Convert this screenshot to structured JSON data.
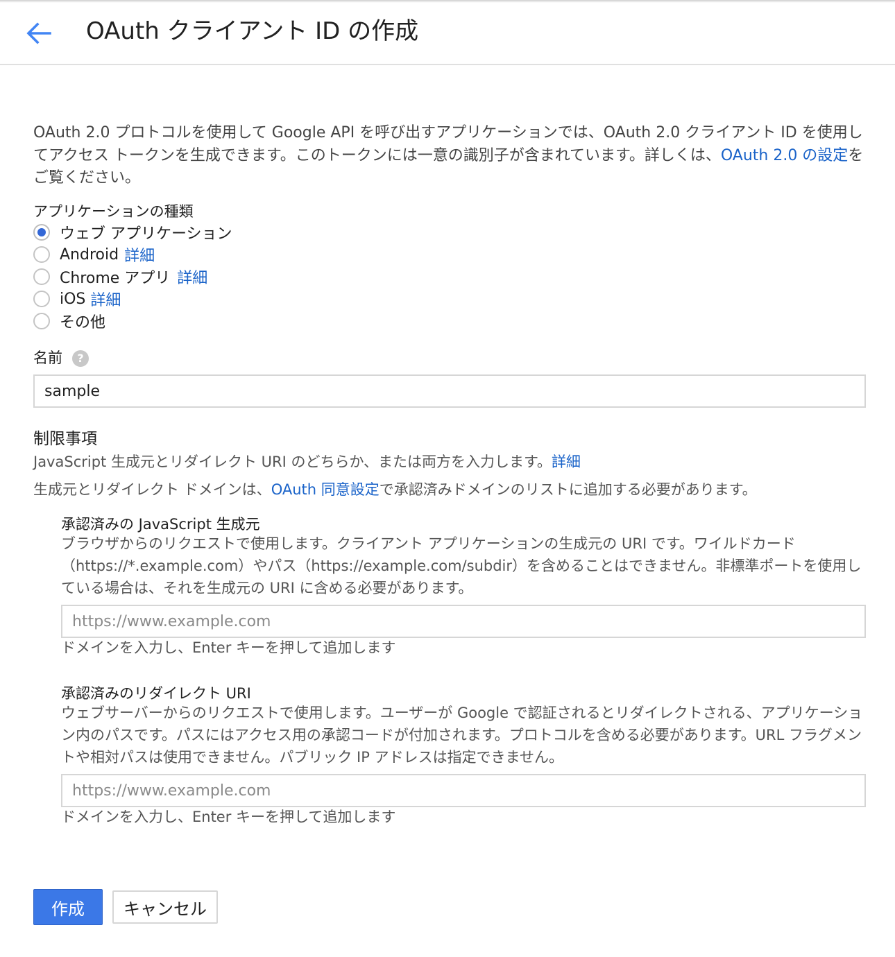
{
  "header": {
    "title": "OAuth クライアント ID の作成",
    "back_icon": "arrow-back-icon",
    "accent_color": "#4285f4"
  },
  "intro": {
    "text_before": "OAuth 2.0 プロトコルを使用して Google API を呼び出すアプリケーションでは、OAuth 2.0 クライアント ID を使用してアクセス トークンを生成できます。このトークンには一意の識別子が含まれています。詳しくは、",
    "link": "OAuth 2.0 の設定",
    "text_after": "をご覧ください。"
  },
  "app_type": {
    "label": "アプリケーションの種類",
    "options": [
      {
        "label": "ウェブ アプリケーション",
        "link": "",
        "checked": true
      },
      {
        "label": "Android",
        "link": "詳細",
        "checked": false
      },
      {
        "label": "Chrome アプリ",
        "link": "詳細",
        "checked": false
      },
      {
        "label": "iOS",
        "link": "詳細",
        "checked": false
      },
      {
        "label": "その他",
        "link": "",
        "checked": false
      }
    ]
  },
  "name": {
    "label": "名前",
    "help_icon": "help-icon",
    "value": "sample"
  },
  "restrictions": {
    "title": "制限事項",
    "desc1_text": "JavaScript 生成元とリダイレクト URI のどちらか、または両方を入力します。",
    "desc1_link": "詳細",
    "desc2_before": "生成元とリダイレクト ドメインは、",
    "desc2_link": "OAuth 同意設定",
    "desc2_after": "で承認済みドメインのリストに追加する必要があります。",
    "js_origins": {
      "title": "承認済みの JavaScript 生成元",
      "description": "ブラウザからのリクエストで使用します。クライアント アプリケーションの生成元の URI です。ワイルドカード（https://*.example.com）やパス（https://example.com/subdir）を含めることはできません。非標準ポートを使用している場合は、それを生成元の URI に含める必要があります。",
      "placeholder": "https://www.example.com",
      "hint": "ドメインを入力し、Enter キーを押して追加します"
    },
    "redirect_uris": {
      "title": "承認済みのリダイレクト URI",
      "description": "ウェブサーバーからのリクエストで使用します。ユーザーが Google で認証されるとリダイレクトされる、アプリケーション内のパスです。パスにはアクセス用の承認コードが付加されます。プロトコルを含める必要があります。URL フラグメントや相対パスは使用できません。パブリック IP アドレスは指定できません。",
      "placeholder": "https://www.example.com",
      "hint": "ドメインを入力し、Enter キーを押して追加します"
    }
  },
  "actions": {
    "create": "作成",
    "cancel": "キャンセル",
    "primary_color": "#3b78e7"
  }
}
